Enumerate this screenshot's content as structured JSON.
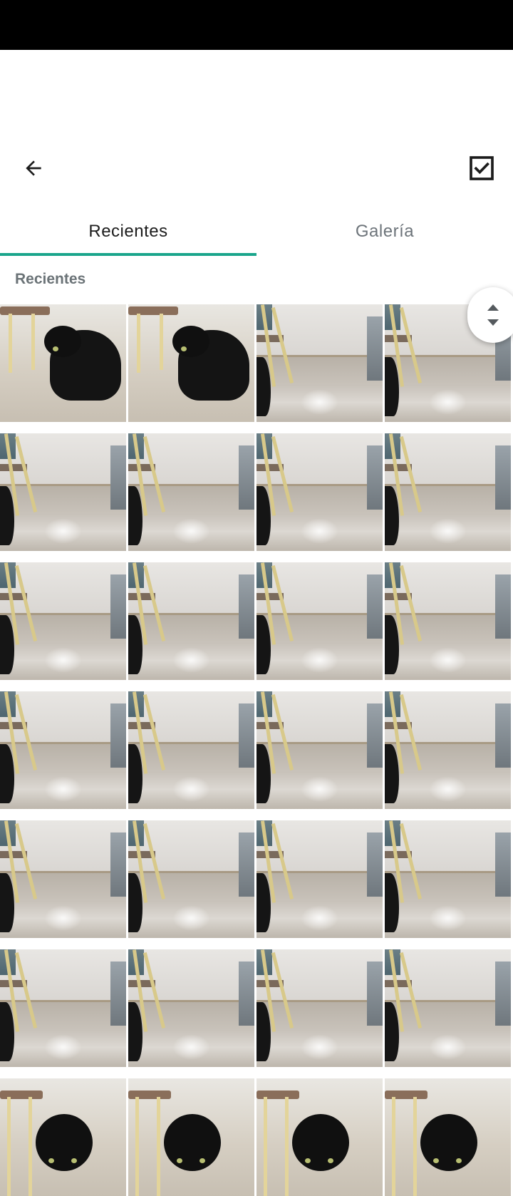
{
  "tabs": [
    {
      "label": "Recientes",
      "active": true
    },
    {
      "label": "Galería",
      "active": false
    }
  ],
  "section_title": "Recientes",
  "icons": {
    "back": "arrow-back-icon",
    "select": "checkbox-checked-icon",
    "scroll": "scroll-handle-icon"
  },
  "colors": {
    "accent": "#1aa58b",
    "tab_active_text": "#1c1c1c",
    "tab_inactive_text": "#6d747a",
    "section_text": "#6b7377"
  },
  "grid": {
    "columns": 4,
    "thumbnails": [
      {
        "scene": "cat"
      },
      {
        "scene": "cat"
      },
      {
        "scene": "room"
      },
      {
        "scene": "room"
      },
      {
        "scene": "room"
      },
      {
        "scene": "room"
      },
      {
        "scene": "room"
      },
      {
        "scene": "room"
      },
      {
        "scene": "room"
      },
      {
        "scene": "room"
      },
      {
        "scene": "room"
      },
      {
        "scene": "room"
      },
      {
        "scene": "room"
      },
      {
        "scene": "room"
      },
      {
        "scene": "room"
      },
      {
        "scene": "room"
      },
      {
        "scene": "room"
      },
      {
        "scene": "room"
      },
      {
        "scene": "room"
      },
      {
        "scene": "room"
      },
      {
        "scene": "room"
      },
      {
        "scene": "room"
      },
      {
        "scene": "room"
      },
      {
        "scene": "room"
      },
      {
        "scene": "cat"
      },
      {
        "scene": "cat"
      },
      {
        "scene": "cat"
      },
      {
        "scene": "cat"
      }
    ]
  }
}
